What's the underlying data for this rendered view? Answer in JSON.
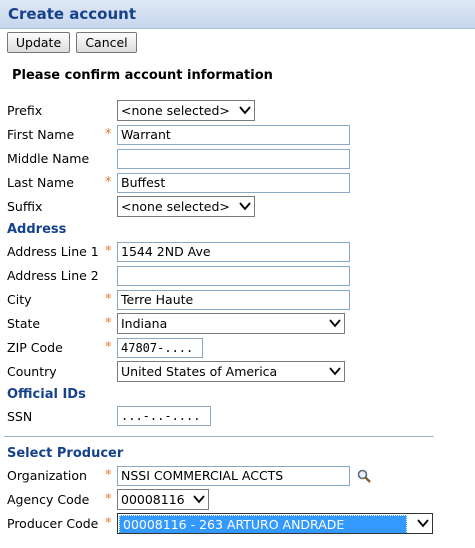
{
  "window": {
    "title": "Create account"
  },
  "toolbar": {
    "update_label": "Update",
    "cancel_label": "Cancel"
  },
  "form": {
    "heading": "Please confirm account information",
    "prefix": {
      "label": "Prefix",
      "value": "<none selected>"
    },
    "first_name": {
      "label": "First Name",
      "value": "Warrant"
    },
    "middle_name": {
      "label": "Middle Name",
      "value": ""
    },
    "last_name": {
      "label": "Last Name",
      "value": "Buffest"
    },
    "suffix": {
      "label": "Suffix",
      "value": "<none selected>"
    }
  },
  "address": {
    "section_title": "Address",
    "line1": {
      "label": "Address Line 1",
      "value": "1544 2ND Ave"
    },
    "line2": {
      "label": "Address Line 2",
      "value": ""
    },
    "city": {
      "label": "City",
      "value": "Terre Haute"
    },
    "state": {
      "label": "State",
      "value": "Indiana"
    },
    "zip": {
      "label": "ZIP Code",
      "value": "47807-...."
    },
    "country": {
      "label": "Country",
      "value": "United States of America"
    }
  },
  "official_ids": {
    "section_title": "Official IDs",
    "ssn": {
      "label": "SSN",
      "value": "...-..-...."
    }
  },
  "producer": {
    "section_title": "Select Producer",
    "organization": {
      "label": "Organization",
      "value": "NSSI COMMERCIAL ACCTS"
    },
    "agency_code": {
      "label": "Agency Code",
      "value": "00008116"
    },
    "producer_code": {
      "label": "Producer Code",
      "value": "00008116 - 263 ARTURO ANDRADE"
    }
  },
  "required_mark": "*",
  "colors": {
    "accent": "#15428b",
    "required": "#e0782d",
    "selection": "#3399ff"
  }
}
